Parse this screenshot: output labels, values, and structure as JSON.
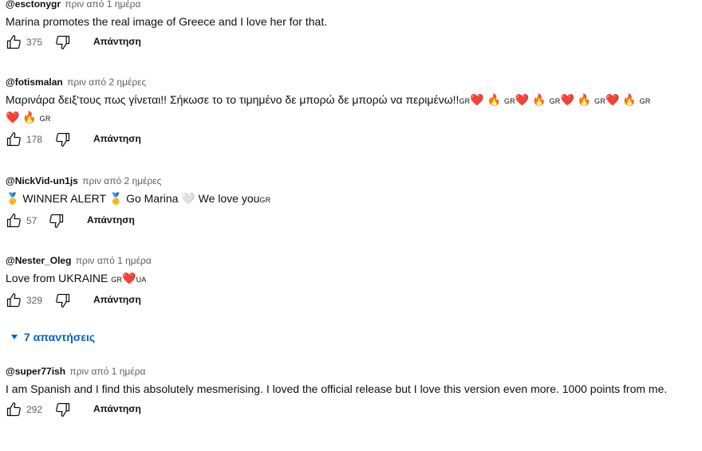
{
  "comments": [
    {
      "author": "@esctonygr",
      "time": "πριν από 1 ημέρα",
      "text": "Marina promotes the real image of Greece and I love her for that.",
      "likes": "375",
      "reply_label": "Απάντηση"
    },
    {
      "author": "@fotismalan",
      "time": "πριν από 2 ημέρες",
      "text_main": "Μαρινάρα δειξ'τους πως γίνεται!! Σήκωσε το το τιμημένο δε μπορώ δε μπορώ να περιμένω!!",
      "flag_gr": "GR",
      "heart": "❤️",
      "fire": "🔥",
      "likes": "178",
      "reply_label": "Απάντηση"
    },
    {
      "author": "@NickVid-un1js",
      "time": "πριν από 2 ημέρες",
      "medal": "🥇",
      "winner_text": "WINNER ALERT",
      "go_text": "Go Marina",
      "white_heart": "🤍",
      "love_text": "We love you",
      "flag_gr": "GR",
      "likes": "57",
      "reply_label": "Απάντηση"
    },
    {
      "author": "@Nester_Oleg",
      "time": "πριν από 1 ημέρα",
      "text": "Love from UKRAINE",
      "flag_gr": "GR",
      "heart": "❤️",
      "flag_ua": "UA",
      "likes": "329",
      "reply_label": "Απάντηση"
    },
    {
      "author": "@super77ish",
      "time": "πριν από 1 ημέρα",
      "text": "I am Spanish and I find this  absolutely mesmerising. I loved the official release but I love this version even more. 1000 points from me.",
      "likes": "292",
      "reply_label": "Απάντηση"
    }
  ],
  "replies_toggle": "7 απαντήσεις",
  "colors": {
    "link_blue": "#065fd4",
    "meta_gray": "#606060",
    "heart_red": "#e0242b"
  }
}
